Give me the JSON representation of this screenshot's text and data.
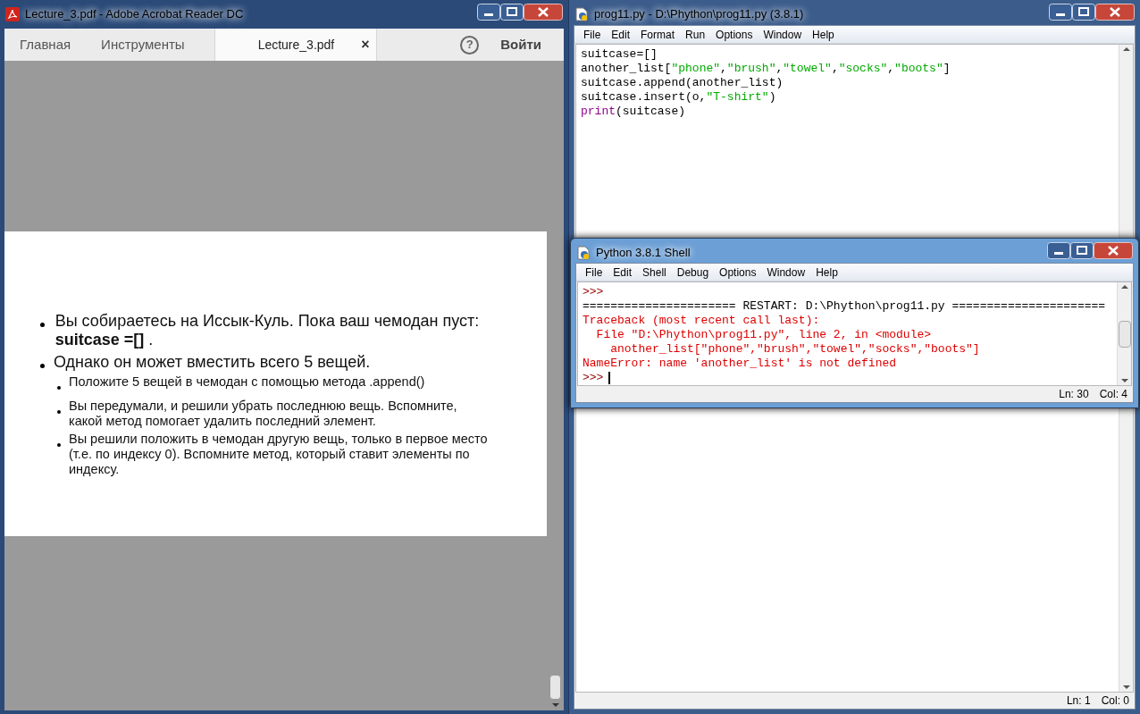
{
  "acrobat": {
    "title": "Lecture_3.pdf - Adobe Acrobat Reader DC",
    "tabs": [
      {
        "label": "Главная",
        "selected": false
      },
      {
        "label": "Инструменты",
        "selected": false
      },
      {
        "label": "Lecture_3.pdf",
        "selected": true,
        "close": "×"
      }
    ],
    "help": "?",
    "login": "Войти",
    "slide": {
      "bullets": [
        {
          "text": "Вы собираетесь на Иссык-Куль. Пока ваш чемодан пуст: **suitcase =[]** ."
        },
        {
          "text": "Однако он может вместить всего 5 вещей.",
          "children": [
            {
              "text": "Положите 5 вещей в чемодан с помощью метода .append()"
            },
            {
              "text": "Вы передумали, и решили убрать последнюю вещь. Вспомните, какой метод помогает удалить последний элемент."
            },
            {
              "text": "Вы решили положить в чемодан другую вещь, только в первое место (т.е. по индексу 0). Вспомните метод, который ставит элементы по индексу."
            }
          ]
        }
      ]
    }
  },
  "editor": {
    "title": "prog11.py - D:\\Phython\\prog11.py (3.8.1)",
    "menu": [
      "File",
      "Edit",
      "Format",
      "Run",
      "Options",
      "Window",
      "Help"
    ],
    "lines": [
      [
        {
          "kind": "plain",
          "text": "suitcase=[]"
        }
      ],
      [
        {
          "kind": "plain",
          "text": "another_list["
        },
        {
          "kind": "string",
          "text": "\"phone\""
        },
        {
          "kind": "plain",
          "text": ","
        },
        {
          "kind": "string",
          "text": "\"brush\""
        },
        {
          "kind": "plain",
          "text": ","
        },
        {
          "kind": "string",
          "text": "\"towel\""
        },
        {
          "kind": "plain",
          "text": ","
        },
        {
          "kind": "string",
          "text": "\"socks\""
        },
        {
          "kind": "plain",
          "text": ","
        },
        {
          "kind": "string",
          "text": "\"boots\""
        },
        {
          "kind": "plain",
          "text": "]"
        }
      ],
      [
        {
          "kind": "plain",
          "text": "suitcase.append(another_list)"
        }
      ],
      [
        {
          "kind": "plain",
          "text": "suitcase.insert(o,"
        },
        {
          "kind": "string",
          "text": "\"T-shirt\""
        },
        {
          "kind": "plain",
          "text": ")"
        }
      ],
      [
        {
          "kind": "builtin",
          "text": "print"
        },
        {
          "kind": "plain",
          "text": "(suitcase)"
        }
      ]
    ],
    "status": {
      "ln": "Ln: 1",
      "col": "Col: 0"
    }
  },
  "shell": {
    "title": "Python 3.8.1 Shell",
    "menu": [
      "File",
      "Edit",
      "Shell",
      "Debug",
      "Options",
      "Window",
      "Help"
    ],
    "lines": [
      [
        {
          "kind": "prompt",
          "text": ">>>"
        }
      ],
      [
        {
          "kind": "plain",
          "text": "====================== RESTART: D:\\Phython\\prog11.py ======================"
        }
      ],
      [
        {
          "kind": "error",
          "text": "Traceback (most recent call last):"
        }
      ],
      [
        {
          "kind": "error",
          "text": "  File \"D:\\Phython\\prog11.py\", line 2, in <module>"
        }
      ],
      [
        {
          "kind": "error",
          "text": "    another_list[\"phone\",\"brush\",\"towel\",\"socks\",\"boots\"]"
        }
      ],
      [
        {
          "kind": "error",
          "text": "NameError: name 'another_list' is not defined"
        }
      ],
      [
        {
          "kind": "prompt",
          "text": ">>>"
        },
        {
          "kind": "cursor"
        }
      ]
    ],
    "status": {
      "ln": "Ln: 30",
      "col": "Col: 4"
    }
  }
}
